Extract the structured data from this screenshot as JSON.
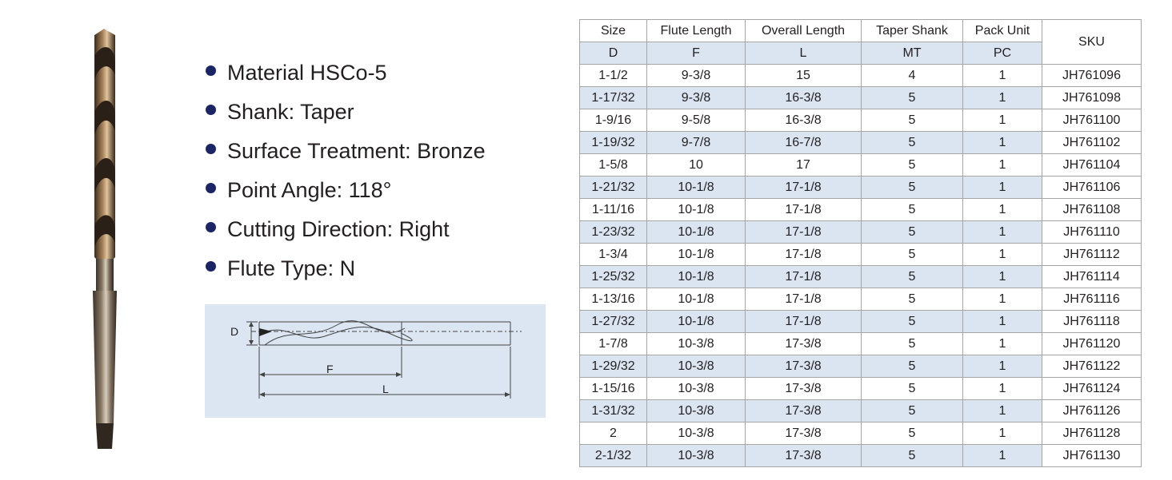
{
  "specs": [
    {
      "label": "Material",
      "sep": "",
      "value": "HSCo-5"
    },
    {
      "label": "Shank",
      "sep": ":",
      "value": "Taper"
    },
    {
      "label": "Surface Treatment",
      "sep": ":",
      "value": "Bronze"
    },
    {
      "label": "Point Angle",
      "sep": ":",
      "value": "118°"
    },
    {
      "label": "Cutting Direction",
      "sep": ":",
      "value": "Right"
    },
    {
      "label": "Flute Type",
      "sep": ":",
      "value": "N"
    }
  ],
  "diagram": {
    "d_label": "D",
    "f_label": "F",
    "l_label": "L"
  },
  "table": {
    "headers": [
      "Size",
      "Flute Length",
      "Overall Length",
      "Taper Shank",
      "Pack Unit",
      "SKU"
    ],
    "subheaders": [
      "D",
      "F",
      "L",
      "MT",
      "PC"
    ],
    "rows": [
      [
        "1-1/2",
        "9-3/8",
        "15",
        "4",
        "1",
        "JH761096"
      ],
      [
        "1-17/32",
        "9-3/8",
        "16-3/8",
        "5",
        "1",
        "JH761098"
      ],
      [
        "1-9/16",
        "9-5/8",
        "16-3/8",
        "5",
        "1",
        "JH761100"
      ],
      [
        "1-19/32",
        "9-7/8",
        "16-7/8",
        "5",
        "1",
        "JH761102"
      ],
      [
        "1-5/8",
        "10",
        "17",
        "5",
        "1",
        "JH761104"
      ],
      [
        "1-21/32",
        "10-1/8",
        "17-1/8",
        "5",
        "1",
        "JH761106"
      ],
      [
        "1-11/16",
        "10-1/8",
        "17-1/8",
        "5",
        "1",
        "JH761108"
      ],
      [
        "1-23/32",
        "10-1/8",
        "17-1/8",
        "5",
        "1",
        "JH761110"
      ],
      [
        "1-3/4",
        "10-1/8",
        "17-1/8",
        "5",
        "1",
        "JH761112"
      ],
      [
        "1-25/32",
        "10-1/8",
        "17-1/8",
        "5",
        "1",
        "JH761114"
      ],
      [
        "1-13/16",
        "10-1/8",
        "17-1/8",
        "5",
        "1",
        "JH761116"
      ],
      [
        "1-27/32",
        "10-1/8",
        "17-1/8",
        "5",
        "1",
        "JH761118"
      ],
      [
        "1-7/8",
        "10-3/8",
        "17-3/8",
        "5",
        "1",
        "JH761120"
      ],
      [
        "1-29/32",
        "10-3/8",
        "17-3/8",
        "5",
        "1",
        "JH761122"
      ],
      [
        "1-15/16",
        "10-3/8",
        "17-3/8",
        "5",
        "1",
        "JH761124"
      ],
      [
        "1-31/32",
        "10-3/8",
        "17-3/8",
        "5",
        "1",
        "JH761126"
      ],
      [
        "2",
        "10-3/8",
        "17-3/8",
        "5",
        "1",
        "JH761128"
      ],
      [
        "2-1/32",
        "10-3/8",
        "17-3/8",
        "5",
        "1",
        "JH761130"
      ]
    ]
  },
  "colors": {
    "bullet": "#1b2566",
    "row_alt": "#dae5f1",
    "diagram_bg": "#dbe6f2",
    "border": "#a6a6a6"
  }
}
